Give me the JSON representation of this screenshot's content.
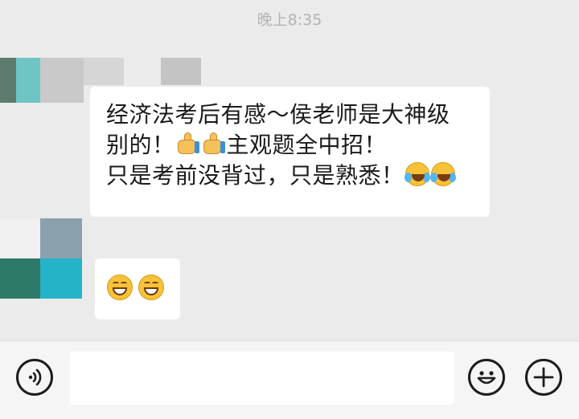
{
  "chat": {
    "timestamp": "晚上8:35",
    "message_1": {
      "line_1": "经济法考后有感～侯老师是大神级",
      "line_2_before_emoji": "别的！",
      "line_2_after_emoji": "主观题全中招！",
      "line_3": "只是考前没背过，只是熟悉！",
      "emojis_line_2": [
        "thumbs-up",
        "thumbs-up"
      ],
      "emojis_line_3": [
        "laughing-crying",
        "laughing-crying"
      ]
    },
    "message_2": {
      "emojis": [
        "grinning",
        "grinning"
      ]
    }
  },
  "input_bar": {
    "text_value": "",
    "icons": [
      "voice-icon",
      "emoji-icon",
      "plus-icon"
    ]
  },
  "colors": {
    "background": "#ebebeb",
    "bubble": "#ffffff",
    "timestamp": "#b3b3b3",
    "input_bar": "#f5f5f5"
  }
}
